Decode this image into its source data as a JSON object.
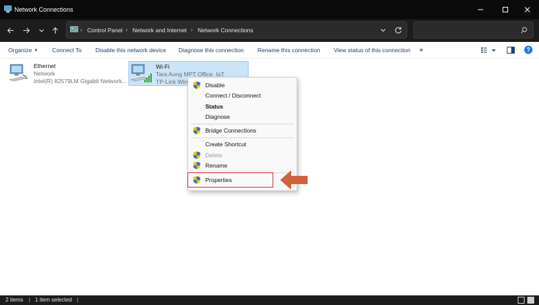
{
  "window": {
    "title": "Network Connections"
  },
  "address": {
    "breadcrumbs": [
      "Control Panel",
      "Network and Internet",
      "Network Connections"
    ],
    "search_placeholder": ""
  },
  "commands": {
    "organize": "Organize",
    "connect_to": "Connect To",
    "disable": "Disable this network device",
    "diagnose": "Diagnose this connection",
    "rename": "Rename this connection",
    "view_status": "View status of this connection",
    "more": "»"
  },
  "items": [
    {
      "name": "Ethernet",
      "line1": "Network",
      "line2": "Intel(R) 82579LM Gigabit Network..."
    },
    {
      "name": "Wi-Fi",
      "line1": "Tara Aung MPT Office_IoT",
      "line2": "TP-Link Wire"
    }
  ],
  "context_menu": {
    "items": [
      {
        "label": "Disable",
        "shield": true,
        "bold": false,
        "disabled": false
      },
      {
        "label": "Connect / Disconnect",
        "shield": false,
        "bold": false,
        "disabled": false
      },
      {
        "label": "Status",
        "shield": false,
        "bold": true,
        "disabled": false
      },
      {
        "label": "Diagnose",
        "shield": false,
        "bold": false,
        "disabled": false
      },
      {
        "label": "Bridge Connections",
        "shield": true,
        "bold": false,
        "disabled": false
      },
      {
        "label": "Create Shortcut",
        "shield": false,
        "bold": false,
        "disabled": false
      },
      {
        "label": "Delete",
        "shield": true,
        "bold": false,
        "disabled": true
      },
      {
        "label": "Rename",
        "shield": true,
        "bold": false,
        "disabled": false
      },
      {
        "label": "Properties",
        "shield": true,
        "bold": false,
        "disabled": false
      }
    ]
  },
  "status": {
    "count": "2 items",
    "selected": "1 item selected"
  },
  "colors": {
    "title_bg": "#0b0b0b",
    "selection_bg": "#cce4f7",
    "highlight_red": "#d93025",
    "arrow_orange": "#d2603c",
    "command_text": "#1e3f6e"
  }
}
